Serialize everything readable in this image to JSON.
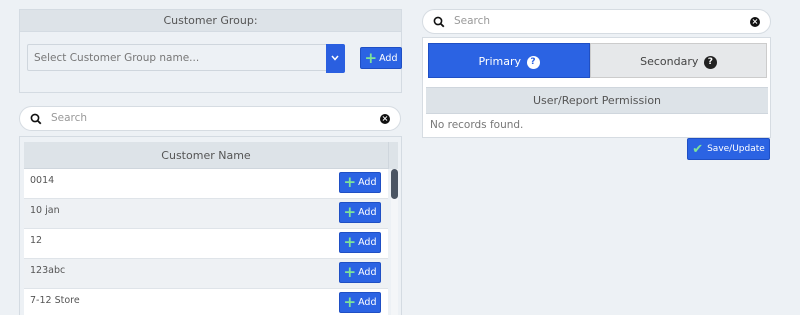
{
  "customer_group": {
    "header": "Customer Group:",
    "select_placeholder": "Select Customer Group name...",
    "add_label": "Add"
  },
  "left_search": {
    "placeholder": "Search"
  },
  "customer_table": {
    "header": "Customer Name",
    "rows": [
      {
        "name": "0014",
        "add_label": "Add"
      },
      {
        "name": "10 jan",
        "add_label": "Add"
      },
      {
        "name": "12",
        "add_label": "Add"
      },
      {
        "name": "123abc",
        "add_label": "Add"
      },
      {
        "name": "7-12 Store",
        "add_label": "Add"
      }
    ]
  },
  "right_search": {
    "placeholder": "Search"
  },
  "tabs": {
    "primary": {
      "label": "Primary",
      "help_icon": "?"
    },
    "secondary": {
      "label": "Secondary",
      "help_icon": "?"
    }
  },
  "permissions": {
    "header": "User/Report Permission",
    "empty_text": "No records found."
  },
  "save_button": {
    "label": "Save/Update"
  },
  "colors": {
    "accent": "#2b63e3",
    "accent_icon": "#7ee39a"
  }
}
